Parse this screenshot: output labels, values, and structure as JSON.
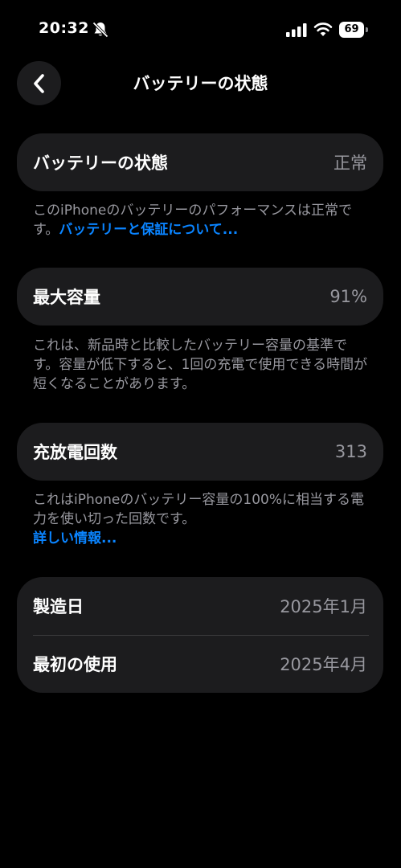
{
  "status_bar": {
    "time": "20:32",
    "battery_level": "69",
    "icons": [
      "bell-slash-icon",
      "cellular-signal-icon",
      "wifi-icon",
      "battery-icon"
    ]
  },
  "nav": {
    "back_icon": "chevron-left-icon",
    "title": "バッテリーの状態"
  },
  "battery_health": {
    "label": "バッテリーの状態",
    "value": "正常",
    "description": "このiPhoneのバッテリーのパフォーマンスは正常です。",
    "link": "バッテリーと保証について..."
  },
  "maximum_capacity": {
    "label": "最大容量",
    "value": "91%",
    "description": "これは、新品時と比較したバッテリー容量の基準です。容量が低下すると、1回の充電で使用できる時間が短くなることがあります。"
  },
  "cycle_count": {
    "label": "充放電回数",
    "value": "313",
    "description": "これはiPhoneのバッテリー容量の100%に相当する電力を使い切った回数です。",
    "link": "詳しい情報..."
  },
  "dates": {
    "manufacture_label": "製造日",
    "manufacture_value": "2025年1月",
    "first_use_label": "最初の使用",
    "first_use_value": "2025年4月"
  },
  "colors": {
    "background": "#000000",
    "card": "#1c1c1e",
    "secondary_text": "#98989f",
    "link": "#0a84ff"
  }
}
